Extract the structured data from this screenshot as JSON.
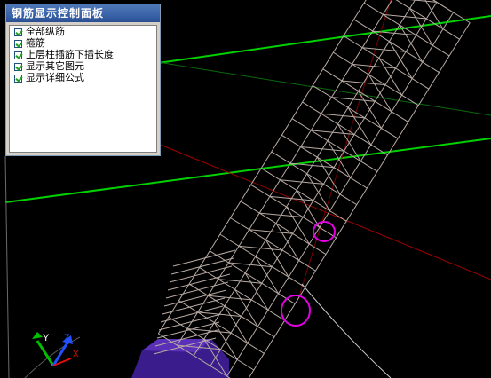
{
  "panel": {
    "title": "钢筋显示控制面板",
    "options": [
      {
        "label": "全部纵筋",
        "checked": true
      },
      {
        "label": "箍筋",
        "checked": true
      },
      {
        "label": "上层柱插筋下插长度",
        "checked": true
      },
      {
        "label": "显示其它图元",
        "checked": true
      },
      {
        "label": "显示详细公式",
        "checked": true
      }
    ]
  },
  "axes": {
    "x": "X",
    "y": "Y",
    "z": "Z"
  },
  "colors": {
    "background": "#000000",
    "rebar": "#b8aba4",
    "grid_line": "#00d200",
    "axis_line": "#b00000",
    "highlight_circle": "#e200e2",
    "concrete": "#3a1c8c"
  }
}
